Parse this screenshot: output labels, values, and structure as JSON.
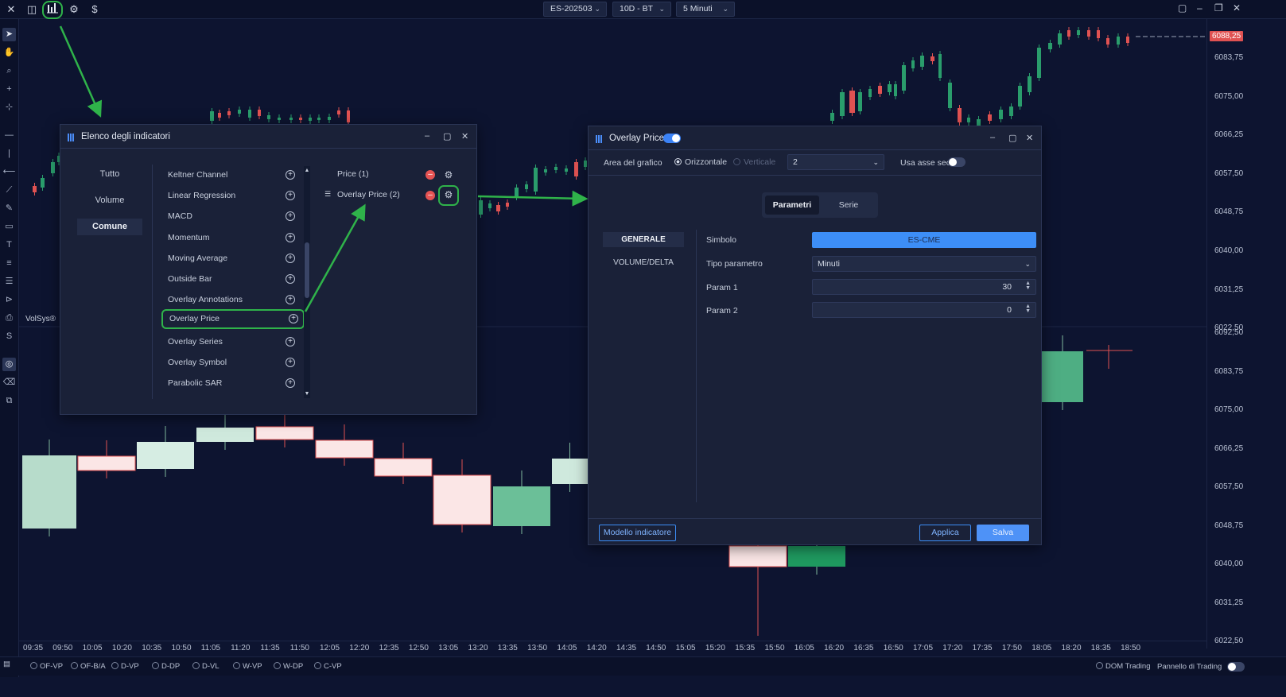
{
  "toolbar": {
    "close_icon": "close-icon",
    "instrument": "ES-202503",
    "template": "10D - BT",
    "timeframe": "5 Minuti"
  },
  "chart_left_label": "VolSys®",
  "price_axis_upper": [
    "6083,75",
    "6075,00",
    "6066,25",
    "6057,50",
    "6048,75",
    "6040,00",
    "6031,25",
    "6022,50"
  ],
  "price_axis_lower": [
    "6092,50",
    "6083,75",
    "6075,00",
    "6066,25",
    "6057,50",
    "6048,75",
    "6040,00",
    "6031,25",
    "6022,50"
  ],
  "last_price": "6088,25",
  "time_axis": [
    "09:35",
    "09:50",
    "10:05",
    "10:20",
    "10:35",
    "10:50",
    "11:05",
    "11:20",
    "11:35",
    "11:50",
    "12:05",
    "12:20",
    "12:35",
    "12:50",
    "13:05",
    "13:20",
    "13:35",
    "13:50",
    "14:05",
    "14:20",
    "14:35",
    "14:50",
    "15:05",
    "15:20",
    "15:35",
    "15:50",
    "16:05",
    "16:20",
    "16:35",
    "16:50",
    "17:05",
    "17:20",
    "17:35",
    "17:50",
    "18:05",
    "18:20",
    "18:35",
    "18:50"
  ],
  "bottombar": {
    "items": [
      "OF-VP",
      "OF-B/A",
      "D-VP",
      "D-DP",
      "D-VL",
      "W-VP",
      "W-DP",
      "C-VP"
    ],
    "dom_trading": "DOM Trading",
    "trading_panel": "Pannello di Trading"
  },
  "indicator_list": {
    "title": "Elenco degli indicatori",
    "categories": [
      "Tutto",
      "Volume",
      "Comune"
    ],
    "active_category": "Comune",
    "items": [
      "Keltner Channel",
      "Linear Regression",
      "MACD",
      "Momentum",
      "Moving Average",
      "Outside Bar",
      "Overlay Annotations",
      "Overlay Price",
      "Overlay Series",
      "Overlay Symbol",
      "Parabolic SAR"
    ],
    "highlighted_item": "Overlay Price",
    "active": [
      "Price (1)",
      "Overlay Price (2)"
    ]
  },
  "overlay_dialog": {
    "title": "Overlay Price",
    "enabled": true,
    "area_label": "Area del grafico",
    "orientation_h": "Orizzontale",
    "orientation_v": "Verticale",
    "area_value": "2",
    "sec_axis_label": "Usa asse sec.",
    "tabs": [
      "Parametri",
      "Serie"
    ],
    "active_tab": "Parametri",
    "sections": [
      "GENERALE",
      "VOLUME/DELTA"
    ],
    "params": {
      "symbol_label": "Simbolo",
      "symbol_value": "ES-CME",
      "type_label": "Tipo parametro",
      "type_value": "Minuti",
      "p1_label": "Param 1",
      "p1_value": "30",
      "p2_label": "Param 2",
      "p2_value": "0"
    },
    "template_button": "Modello indicatore",
    "apply_button": "Applica",
    "save_button": "Salva"
  },
  "colors": {
    "bg": "#0d1430",
    "panel": "#1a2138",
    "accent": "#3d8ef7",
    "up": "#2a9d6c",
    "down": "#e05252",
    "highlight": "#2fb34a"
  }
}
